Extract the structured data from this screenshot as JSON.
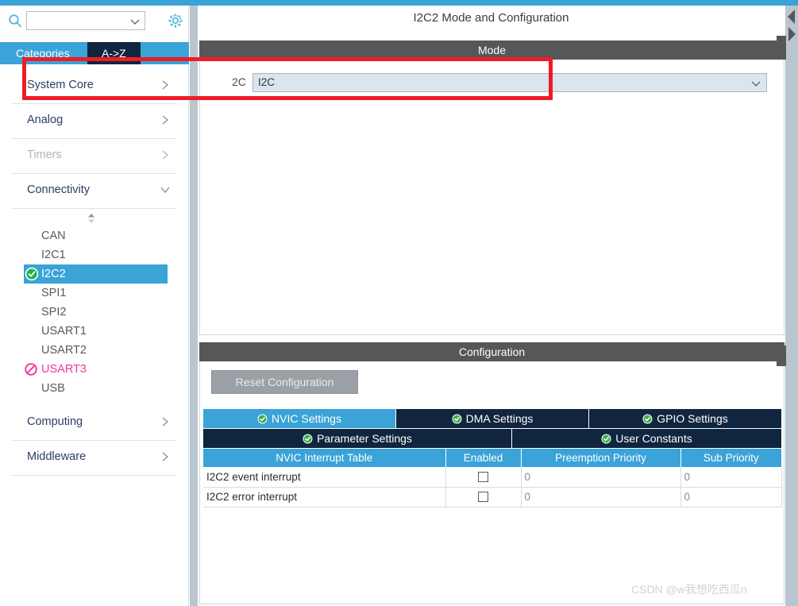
{
  "app": {
    "accent_blue": "#3aa3d8",
    "dark_navy": "#10253f",
    "band_gray": "#555759",
    "highlight_red": "#ee1c25",
    "blocked_pink": "#f0359a"
  },
  "sidebar": {
    "search": {
      "value": "",
      "placeholder": "",
      "icon": "search-icon",
      "chevron": "chevron-down-icon"
    },
    "gear": {
      "icon": "gear-icon"
    },
    "tabs": [
      {
        "label": "Categories",
        "active": true
      },
      {
        "label": "A->Z",
        "active": false
      }
    ],
    "categories": [
      {
        "label": "System Core",
        "expanded": false,
        "disabled": false,
        "arrow": "chevron-right-icon"
      },
      {
        "label": "Analog",
        "expanded": false,
        "disabled": false,
        "arrow": "chevron-right-icon"
      },
      {
        "label": "Timers",
        "expanded": false,
        "disabled": true,
        "arrow": "chevron-right-icon"
      },
      {
        "label": "Connectivity",
        "expanded": true,
        "disabled": false,
        "arrow": "chevron-down-icon"
      }
    ],
    "peripherals": [
      {
        "label": "CAN",
        "state": "none",
        "selected": false
      },
      {
        "label": "I2C1",
        "state": "none",
        "selected": false
      },
      {
        "label": "I2C2",
        "state": "configured",
        "selected": true
      },
      {
        "label": "SPI1",
        "state": "none",
        "selected": false
      },
      {
        "label": "SPI2",
        "state": "none",
        "selected": false
      },
      {
        "label": "USART1",
        "state": "none",
        "selected": false
      },
      {
        "label": "USART2",
        "state": "none",
        "selected": false
      },
      {
        "label": "USART3",
        "state": "blocked",
        "selected": false
      },
      {
        "label": "USB",
        "state": "none",
        "selected": false
      }
    ],
    "categories_bottom": [
      {
        "label": "Computing",
        "expanded": false,
        "disabled": false,
        "arrow": "chevron-right-icon"
      },
      {
        "label": "Middleware",
        "expanded": false,
        "disabled": false,
        "arrow": "chevron-right-icon"
      }
    ]
  },
  "main": {
    "title": "I2C2 Mode and Configuration",
    "mode": {
      "band_label": "Mode",
      "field_label": "2C",
      "select_value": "I2C",
      "select_arrow": "chevron-down-icon"
    },
    "configuration": {
      "band_label": "Configuration",
      "reset_button": "Reset Configuration",
      "tabs_row1": [
        {
          "label": "NVIC Settings",
          "active": true
        },
        {
          "label": "DMA Settings",
          "active": false
        },
        {
          "label": "GPIO Settings",
          "active": false
        }
      ],
      "tabs_row2": [
        {
          "label": "Parameter Settings",
          "active": false
        },
        {
          "label": "User Constants",
          "active": false
        }
      ],
      "table": {
        "headers": [
          "NVIC Interrupt Table",
          "Enabled",
          "Preemption Priority",
          "Sub Priority"
        ],
        "rows": [
          {
            "name": "I2C2 event interrupt",
            "enabled": false,
            "preemption": "0",
            "sub": "0"
          },
          {
            "name": "I2C2 error interrupt",
            "enabled": false,
            "preemption": "0",
            "sub": "0"
          }
        ]
      }
    }
  },
  "watermark": {
    "text": "CSDN @w我想吃西瓜n"
  }
}
